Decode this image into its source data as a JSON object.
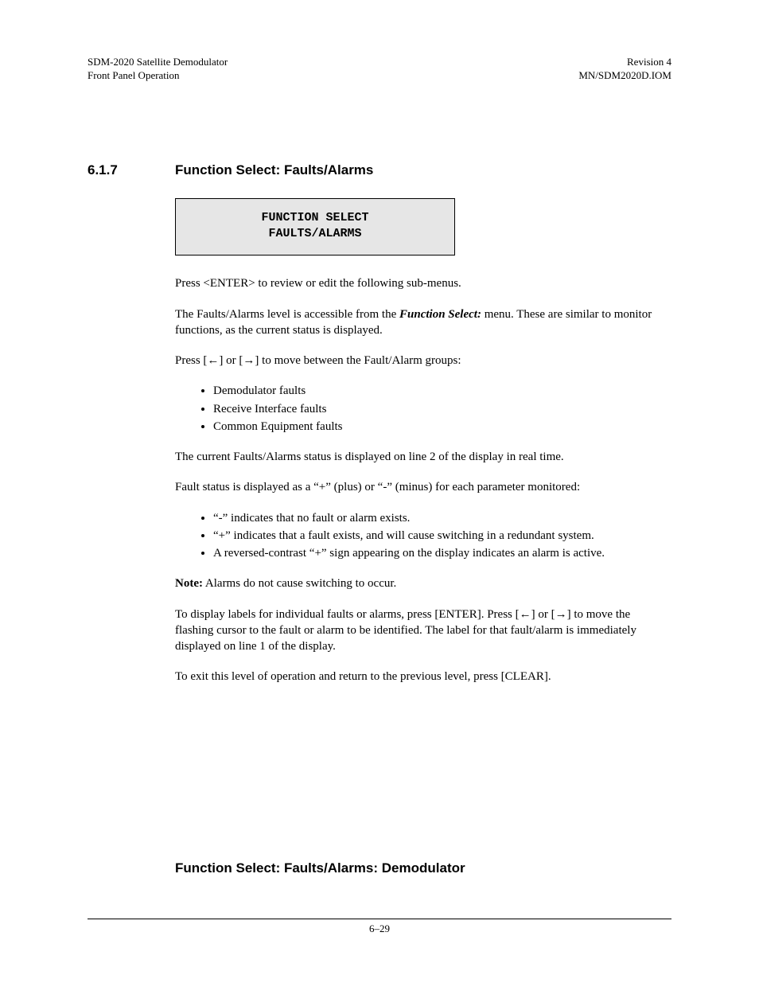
{
  "header": {
    "left1": "SDM-2020 Satellite Demodulator",
    "left2": "Front Panel Operation",
    "right1": "Revision 4",
    "right2": "MN/SDM2020D.IOM"
  },
  "section": {
    "number": "6.1.7",
    "title": "Function Select: Faults/Alarms"
  },
  "display": {
    "line1": "FUNCTION SELECT",
    "line2": "FAULTS/ALARMS"
  },
  "p1": "Press <ENTER> to review or edit the following sub-menus.",
  "p2a": "The Faults/Alarms level is accessible from the ",
  "p2b": "Function Select:",
  "p2c": "  menu. These are similar to monitor functions, as the current status is displayed.",
  "p3": "Press [←] or [→] to move between the Fault/Alarm groups:",
  "list1": [
    "Demodulator faults",
    "Receive Interface faults",
    "Common Equipment faults"
  ],
  "p4": "The current Faults/Alarms status is displayed on line 2 of the display in real time.",
  "p5": "Fault status is displayed as a “+” (plus) or “-” (minus) for each parameter monitored:",
  "list2": [
    "“-” indicates that no fault or alarm exists.",
    "“+” indicates that a fault exists, and will cause switching in a redundant system.",
    "A reversed-contrast “+” sign appearing on the display indicates an alarm is active."
  ],
  "note_label": "Note:",
  "note_text": " Alarms do not cause switching to occur.",
  "p6": "To display labels for individual faults or alarms, press [ENTER]. Press [←] or [→] to move the flashing cursor to the fault or alarm to be identified. The label for that fault/alarm is immediately displayed on line 1 of the display.",
  "p7": "To exit this level of operation and return to the previous level, press [CLEAR].",
  "subheading": "Function Select: Faults/Alarms: Demodulator",
  "footer": "6–29"
}
